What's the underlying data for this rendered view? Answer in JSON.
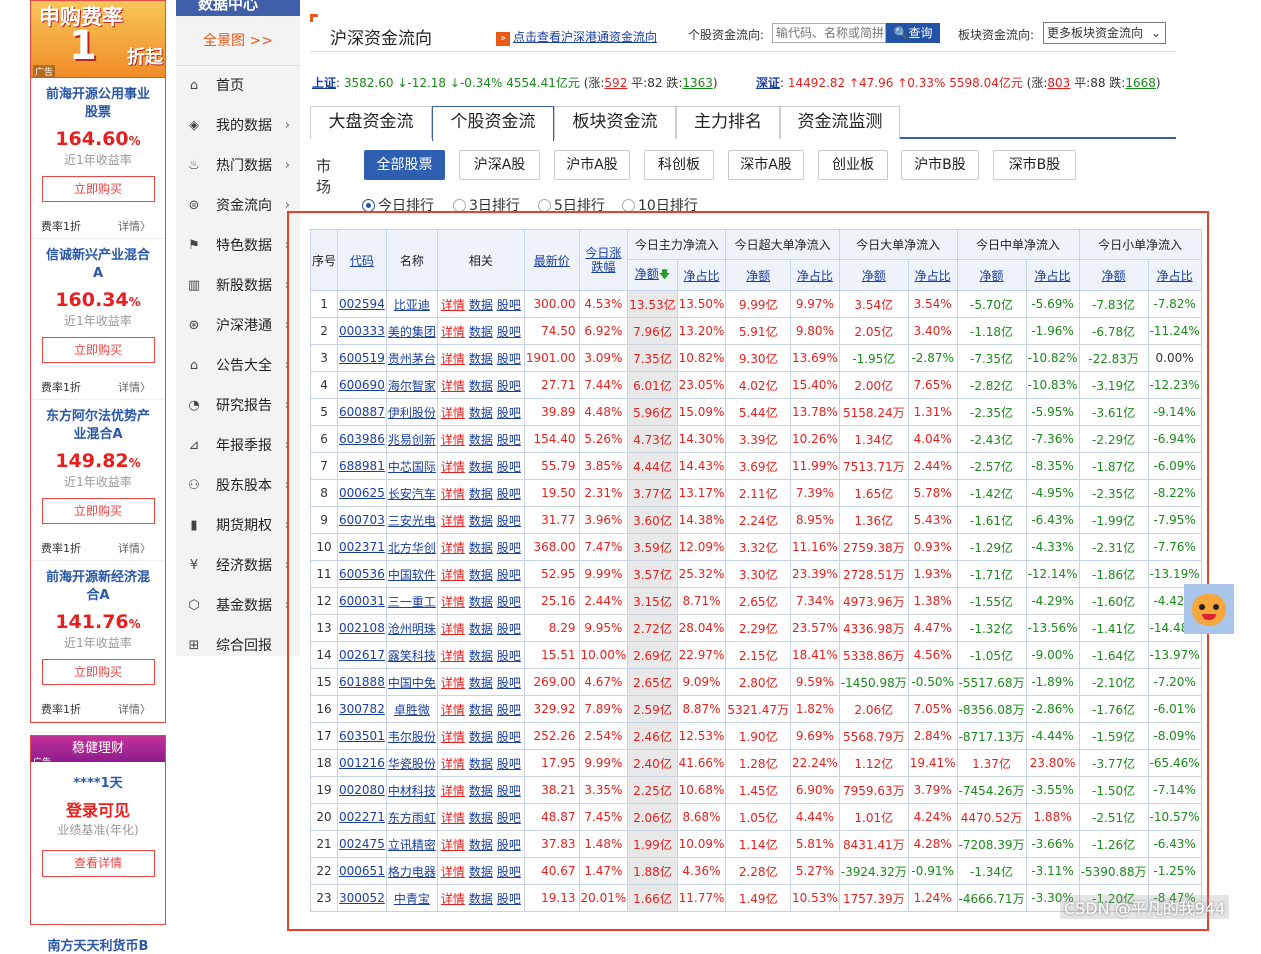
{
  "ads": {
    "top_banner": {
      "line1": "申购费率",
      "line2": "1",
      "line3": "折起",
      "tag": "广告"
    },
    "funds": [
      {
        "name": "前海开源公用事业股票",
        "rate": "164.60",
        "unit": "%",
        "label": "近1年收益率",
        "buy": "立即购买",
        "fee": "费率1折",
        "detail": "详情〉"
      },
      {
        "name": "信诚新兴产业混合A",
        "rate": "160.34",
        "unit": "%",
        "label": "近1年收益率",
        "buy": "立即购买",
        "fee": "费率1折",
        "detail": "详情〉"
      },
      {
        "name": "东方阿尔法优势产业混合A",
        "rate": "149.82",
        "unit": "%",
        "label": "近1年收益率",
        "buy": "立即购买",
        "fee": "费率1折",
        "detail": "详情〉"
      },
      {
        "name": "前海开源新经济混合A",
        "rate": "141.76",
        "unit": "%",
        "label": "近1年收益率",
        "buy": "立即购买",
        "fee": "费率1折",
        "detail": "详情〉"
      }
    ],
    "stable": {
      "header": "稳健理财",
      "tag": "广告",
      "duration": "****1天",
      "value": "登录可见",
      "label": "业绩基准(年化)",
      "button": "查看详情",
      "next": "南方天天利货币B"
    }
  },
  "nav": {
    "brand": "数据中心",
    "full_map": "全景图 >>",
    "items": [
      {
        "label": "首页",
        "icon": "⌂",
        "arrow": ""
      },
      {
        "label": "我的数据",
        "icon": "◈",
        "arrow": "›"
      },
      {
        "label": "热门数据",
        "icon": "♨",
        "arrow": "›"
      },
      {
        "label": "资金流向",
        "icon": "⊜",
        "arrow": "›"
      },
      {
        "label": "特色数据",
        "icon": "⚑",
        "arrow": "›"
      },
      {
        "label": "新股数据",
        "icon": "▥",
        "arrow": "›"
      },
      {
        "label": "沪深港通",
        "icon": "⊛",
        "arrow": "›"
      },
      {
        "label": "公告大全",
        "icon": "⌂",
        "arrow": "›"
      },
      {
        "label": "研究报告",
        "icon": "◔",
        "arrow": "›"
      },
      {
        "label": "年报季报",
        "icon": "⊿",
        "arrow": "›"
      },
      {
        "label": "股东股本",
        "icon": "⚇",
        "arrow": "›"
      },
      {
        "label": "期货期权",
        "icon": "▮",
        "arrow": "›"
      },
      {
        "label": "经济数据",
        "icon": "¥",
        "arrow": "›"
      },
      {
        "label": "基金数据",
        "icon": "⬡",
        "arrow": "›"
      },
      {
        "label": "综合回报",
        "icon": "⊞",
        "arrow": ""
      }
    ]
  },
  "header": {
    "title": "沪深资金流向",
    "hk_link_icon": "»",
    "hk_link": "点击查看沪深港通资金流向",
    "stock_label": "个股资金流向:",
    "search_placeholder": "输代码、名称或简拼",
    "search_btn": "🔍查询",
    "sector_label": "板块资金流向:",
    "sector_select": "更多板块资金流向",
    "select_arrow": "⌄"
  },
  "index_bar": {
    "sh": {
      "name": "上证",
      "price": "3582.60",
      "chg": "↓-12.18",
      "pct": "↓-0.34%",
      "amt": "4554.41亿元",
      "up": "592",
      "flat": "82",
      "down": "1363"
    },
    "sz": {
      "name": "深证",
      "price": "14492.82",
      "chg": "↑47.96",
      "pct": "↑0.33%",
      "amt": "5598.04亿元",
      "up": "803",
      "flat": "88",
      "down": "1668"
    },
    "lbl_up": "涨:",
    "lbl_flat": "平:",
    "lbl_down": "跌:"
  },
  "tabs": [
    "大盘资金流",
    "个股资金流",
    "板块资金流",
    "主力排名",
    "资金流监测"
  ],
  "market": {
    "label": "市场",
    "options": [
      "全部股票",
      "沪深A股",
      "沪市A股",
      "科创板",
      "深市A股",
      "创业板",
      "沪市B股",
      "深市B股"
    ]
  },
  "periods": [
    "今日排行",
    "3日排行",
    "5日排行",
    "10日排行"
  ],
  "table": {
    "head1": {
      "no": "序号",
      "code": "代码",
      "name": "名称",
      "rel": "相关",
      "price": "最新价",
      "chg": "今日涨跌幅",
      "g1": "今日主力净流入",
      "g2": "今日超大单净流入",
      "g3": "今日大单净流入",
      "g4": "今日中单净流入",
      "g5": "今日小单净流入"
    },
    "sub": {
      "amt": "净额",
      "pct": "净占比",
      "sort_arrow": "🡇"
    },
    "rel_links": [
      "详情",
      "数据",
      "股吧"
    ],
    "rows": [
      [
        "1",
        "002594",
        "比亚迪",
        "300.00",
        "4.53%",
        "13.53亿",
        "13.50%",
        "9.99亿",
        "9.97%",
        "3.54亿",
        "3.54%",
        "-5.70亿",
        "-5.69%",
        "-7.83亿",
        "-7.82%"
      ],
      [
        "2",
        "000333",
        "美的集团",
        "74.50",
        "6.92%",
        "7.96亿",
        "13.20%",
        "5.91亿",
        "9.80%",
        "2.05亿",
        "3.40%",
        "-1.18亿",
        "-1.96%",
        "-6.78亿",
        "-11.24%"
      ],
      [
        "3",
        "600519",
        "贵州茅台",
        "1901.00",
        "3.09%",
        "7.35亿",
        "10.82%",
        "9.30亿",
        "13.69%",
        "-1.95亿",
        "-2.87%",
        "-7.35亿",
        "-10.82%",
        "-22.83万",
        "0.00%"
      ],
      [
        "4",
        "600690",
        "海尔智家",
        "27.71",
        "7.44%",
        "6.01亿",
        "23.05%",
        "4.02亿",
        "15.40%",
        "2.00亿",
        "7.65%",
        "-2.82亿",
        "-10.83%",
        "-3.19亿",
        "-12.23%"
      ],
      [
        "5",
        "600887",
        "伊利股份",
        "39.89",
        "4.48%",
        "5.96亿",
        "15.09%",
        "5.44亿",
        "13.78%",
        "5158.24万",
        "1.31%",
        "-2.35亿",
        "-5.95%",
        "-3.61亿",
        "-9.14%"
      ],
      [
        "6",
        "603986",
        "兆易创新",
        "154.40",
        "5.26%",
        "4.73亿",
        "14.30%",
        "3.39亿",
        "10.26%",
        "1.34亿",
        "4.04%",
        "-2.43亿",
        "-7.36%",
        "-2.29亿",
        "-6.94%"
      ],
      [
        "7",
        "688981",
        "中芯国际",
        "55.79",
        "3.85%",
        "4.44亿",
        "14.43%",
        "3.69亿",
        "11.99%",
        "7513.71万",
        "2.44%",
        "-2.57亿",
        "-8.35%",
        "-1.87亿",
        "-6.09%"
      ],
      [
        "8",
        "000625",
        "长安汽车",
        "19.50",
        "2.31%",
        "3.77亿",
        "13.17%",
        "2.11亿",
        "7.39%",
        "1.65亿",
        "5.78%",
        "-1.42亿",
        "-4.95%",
        "-2.35亿",
        "-8.22%"
      ],
      [
        "9",
        "600703",
        "三安光电",
        "31.77",
        "3.96%",
        "3.60亿",
        "14.38%",
        "2.24亿",
        "8.95%",
        "1.36亿",
        "5.43%",
        "-1.61亿",
        "-6.43%",
        "-1.99亿",
        "-7.95%"
      ],
      [
        "10",
        "002371",
        "北方华创",
        "368.00",
        "7.47%",
        "3.59亿",
        "12.09%",
        "3.32亿",
        "11.16%",
        "2759.38万",
        "0.93%",
        "-1.29亿",
        "-4.33%",
        "-2.31亿",
        "-7.76%"
      ],
      [
        "11",
        "600536",
        "中国软件",
        "52.95",
        "9.99%",
        "3.57亿",
        "25.32%",
        "3.30亿",
        "23.39%",
        "2728.51万",
        "1.93%",
        "-1.71亿",
        "-12.14%",
        "-1.86亿",
        "-13.19%"
      ],
      [
        "12",
        "600031",
        "三一重工",
        "25.16",
        "2.44%",
        "3.15亿",
        "8.71%",
        "2.65亿",
        "7.34%",
        "4973.96万",
        "1.38%",
        "-1.55亿",
        "-4.29%",
        "-1.60亿",
        "-4.42%"
      ],
      [
        "13",
        "002108",
        "沧州明珠",
        "8.29",
        "9.95%",
        "2.72亿",
        "28.04%",
        "2.29亿",
        "23.57%",
        "4336.98万",
        "4.47%",
        "-1.32亿",
        "-13.56%",
        "-1.41亿",
        "-14.48%"
      ],
      [
        "14",
        "002617",
        "露笑科技",
        "15.51",
        "10.00%",
        "2.69亿",
        "22.97%",
        "2.15亿",
        "18.41%",
        "5338.86万",
        "4.56%",
        "-1.05亿",
        "-9.00%",
        "-1.64亿",
        "-13.97%"
      ],
      [
        "15",
        "601888",
        "中国中免",
        "269.00",
        "4.67%",
        "2.65亿",
        "9.09%",
        "2.80亿",
        "9.59%",
        "-1450.98万",
        "-0.50%",
        "-5517.68万",
        "-1.89%",
        "-2.10亿",
        "-7.20%"
      ],
      [
        "16",
        "300782",
        "卓胜微",
        "329.92",
        "7.89%",
        "2.59亿",
        "8.87%",
        "5321.47万",
        "1.82%",
        "2.06亿",
        "7.05%",
        "-8356.08万",
        "-2.86%",
        "-1.76亿",
        "-6.01%"
      ],
      [
        "17",
        "603501",
        "韦尔股份",
        "252.26",
        "2.54%",
        "2.46亿",
        "12.53%",
        "1.90亿",
        "9.69%",
        "5568.79万",
        "2.84%",
        "-8717.13万",
        "-4.44%",
        "-1.59亿",
        "-8.09%"
      ],
      [
        "18",
        "001216",
        "华瓷股份",
        "17.95",
        "9.99%",
        "2.40亿",
        "41.66%",
        "1.28亿",
        "22.24%",
        "1.12亿",
        "19.41%",
        "1.37亿",
        "23.80%",
        "-3.77亿",
        "-65.46%"
      ],
      [
        "19",
        "002080",
        "中材科技",
        "38.21",
        "3.35%",
        "2.25亿",
        "10.68%",
        "1.45亿",
        "6.90%",
        "7959.63万",
        "3.79%",
        "-7454.26万",
        "-3.55%",
        "-1.50亿",
        "-7.14%"
      ],
      [
        "20",
        "002271",
        "东方雨虹",
        "48.87",
        "7.45%",
        "2.06亿",
        "8.68%",
        "1.05亿",
        "4.44%",
        "1.01亿",
        "4.24%",
        "4470.52万",
        "1.88%",
        "-2.51亿",
        "-10.57%"
      ],
      [
        "21",
        "002475",
        "立讯精密",
        "37.83",
        "1.48%",
        "1.99亿",
        "10.09%",
        "1.14亿",
        "5.81%",
        "8431.41万",
        "4.28%",
        "-7208.39万",
        "-3.66%",
        "-1.26亿",
        "-6.43%"
      ],
      [
        "22",
        "000651",
        "格力电器",
        "40.67",
        "1.47%",
        "1.88亿",
        "4.36%",
        "2.28亿",
        "5.27%",
        "-3924.32万",
        "-0.91%",
        "-1.34亿",
        "-3.11%",
        "-5390.88万",
        "-1.25%"
      ],
      [
        "23",
        "300052",
        "中青宝",
        "19.13",
        "20.01%",
        "1.66亿",
        "11.77%",
        "1.49亿",
        "10.53%",
        "1757.39万",
        "1.24%",
        "-4666.71万",
        "-3.30%",
        "-1.20亿",
        "-8.47%"
      ]
    ]
  },
  "watermark": "CSDN @平凡的我944",
  "colors": {
    "up": "#e6201e",
    "down": "#1a8a1a",
    "link": "#1a3fa0",
    "accent": "#2f5fb0",
    "frame": "#e8402a"
  }
}
